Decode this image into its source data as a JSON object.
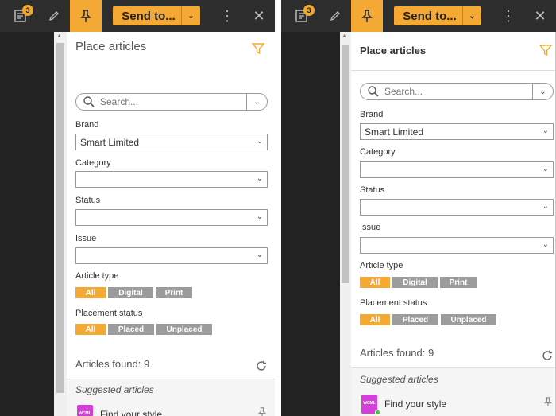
{
  "topbar": {
    "notes_badge": "3",
    "send_label": "Send to...",
    "more_glyph": "⋮",
    "close_glyph": "✕",
    "icons": [
      "notes-icon",
      "pencil-icon",
      "pin-icon",
      "chevron-down-icon",
      "more-icon",
      "close-icon"
    ]
  },
  "left_panel": {
    "title": "Place articles",
    "search_placeholder": "Search...",
    "brand": {
      "label": "Brand",
      "value": "Smart Limited"
    },
    "category": {
      "label": "Category",
      "value": ""
    },
    "status": {
      "label": "Status",
      "value": ""
    },
    "issue": {
      "label": "Issue",
      "value": ""
    },
    "article_type": {
      "label": "Article type",
      "chips": [
        "All",
        "Digital",
        "Print"
      ]
    },
    "placement_status": {
      "label": "Placement status",
      "chips": [
        "All",
        "Placed",
        "Unplaced"
      ]
    },
    "found": "Articles found: 9",
    "suggested_title": "Suggested articles",
    "article": {
      "title": "Find your style",
      "type_badge": "WCML"
    }
  },
  "right_panel": {
    "title": "Place articles",
    "search_placeholder": "Search...",
    "brand": {
      "label": "Brand",
      "value": "Smart Limited"
    },
    "category": {
      "label": "Category",
      "value": ""
    },
    "status": {
      "label": "Status",
      "value": ""
    },
    "issue": {
      "label": "Issue",
      "value": ""
    },
    "article_type": {
      "label": "Article type",
      "chips": [
        "All",
        "Digital",
        "Print"
      ]
    },
    "placement_status": {
      "label": "Placement status",
      "chips": [
        "All",
        "Placed",
        "Unplaced"
      ]
    },
    "found": "Articles found: 9",
    "suggested_title": "Suggested articles",
    "article": {
      "title": "Find your style",
      "type_badge": "WCML"
    }
  },
  "colors": {
    "accent": "#f4a934",
    "topbar": "#2d2d2d",
    "chip_inactive": "#9c9c9c",
    "badge": "#f0a92e",
    "article_icon": "#d43ed9"
  }
}
